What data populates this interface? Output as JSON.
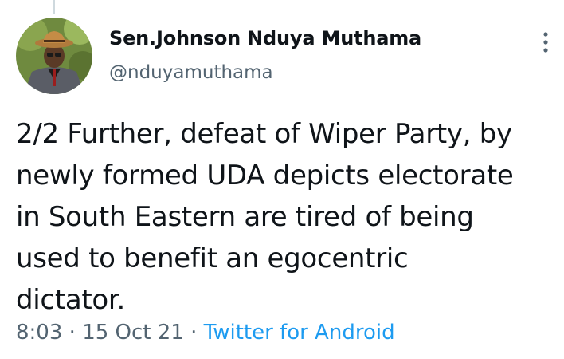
{
  "author": {
    "display_name": "Sen.Johnson Nduya Muthama",
    "handle": "@nduyamuthama"
  },
  "tweet": {
    "text": "2/2 Further, defeat of Wiper Party, by\nnewly formed UDA depicts electorate\nin South Eastern are tired of being\nused to benefit an egocentric\ndictator.",
    "time": "8:03",
    "separator": "·",
    "date": "15 Oct 21",
    "source": "Twitter for Android"
  },
  "colors": {
    "text": "#0f1419",
    "secondary": "#536471",
    "link": "#1d9bf0",
    "thread_line": "#cfd9de"
  },
  "icons": {
    "more": "more-vertical-icon"
  }
}
